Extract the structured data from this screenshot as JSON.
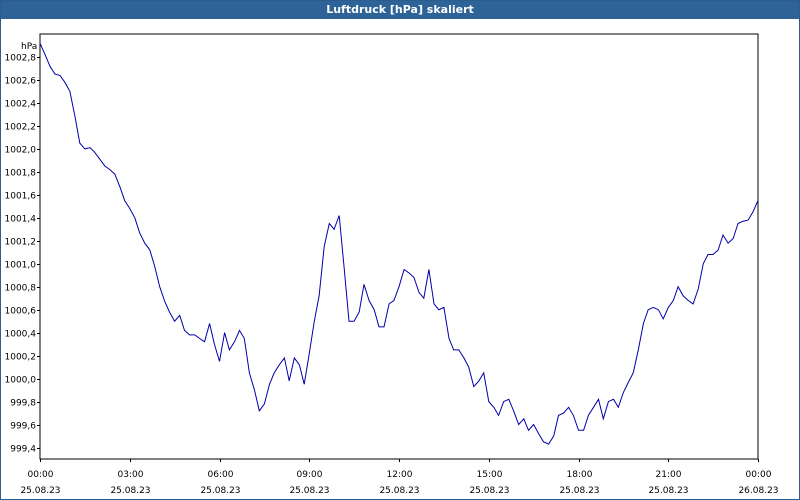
{
  "window": {
    "title": "Luftdruck [hPa] skaliert"
  },
  "chart_data": {
    "type": "line",
    "title": "Luftdruck [hPa] skaliert",
    "ylabel": "hPa",
    "xlabel": "",
    "ylim": [
      999.3,
      1003.0
    ],
    "xlim": [
      0,
      24
    ],
    "grid": true,
    "y_ticks": [
      {
        "value": 999.4,
        "label": "999,4"
      },
      {
        "value": 999.6,
        "label": "999,6"
      },
      {
        "value": 999.8,
        "label": "999,8"
      },
      {
        "value": 1000.0,
        "label": "1000,0"
      },
      {
        "value": 1000.2,
        "label": "1000,2"
      },
      {
        "value": 1000.4,
        "label": "1000,4"
      },
      {
        "value": 1000.6,
        "label": "1000,6"
      },
      {
        "value": 1000.8,
        "label": "1000,8"
      },
      {
        "value": 1001.0,
        "label": "1001,0"
      },
      {
        "value": 1001.2,
        "label": "1001,2"
      },
      {
        "value": 1001.4,
        "label": "1001,4"
      },
      {
        "value": 1001.6,
        "label": "1001,6"
      },
      {
        "value": 1001.8,
        "label": "1001,8"
      },
      {
        "value": 1002.0,
        "label": "1002,0"
      },
      {
        "value": 1002.2,
        "label": "1002,2"
      },
      {
        "value": 1002.4,
        "label": "1002,4"
      },
      {
        "value": 1002.6,
        "label": "1002,6"
      },
      {
        "value": 1002.8,
        "label": "1002,8"
      }
    ],
    "x_ticks": [
      {
        "value": 0,
        "time": "00:00",
        "date": "25.08.23"
      },
      {
        "value": 3,
        "time": "03:00",
        "date": "25.08.23"
      },
      {
        "value": 6,
        "time": "06:00",
        "date": "25.08.23"
      },
      {
        "value": 9,
        "time": "09:00",
        "date": "25.08.23"
      },
      {
        "value": 12,
        "time": "12:00",
        "date": "25.08.23"
      },
      {
        "value": 15,
        "time": "15:00",
        "date": "25.08.23"
      },
      {
        "value": 18,
        "time": "18:00",
        "date": "25.08.23"
      },
      {
        "value": 21,
        "time": "21:00",
        "date": "25.08.23"
      },
      {
        "value": 24,
        "time": "00:00",
        "date": "26.08.23"
      }
    ],
    "line_color": "#0000aa",
    "series": [
      {
        "x": [
          0,
          0.17,
          0.33,
          0.5,
          0.67,
          0.83,
          1.0,
          1.17,
          1.33,
          1.5,
          1.67,
          1.83,
          2.0,
          2.17,
          2.33,
          2.5,
          2.67,
          2.83,
          3.0,
          3.17,
          3.33,
          3.5,
          3.67,
          3.83,
          4.0,
          4.17,
          4.33,
          4.5,
          4.67,
          4.83,
          5.0,
          5.17,
          5.33,
          5.5,
          5.67,
          5.83,
          6.0,
          6.17,
          6.33,
          6.5,
          6.67,
          6.83,
          7.0,
          7.17,
          7.33,
          7.5,
          7.67,
          7.83,
          8.0,
          8.17,
          8.33,
          8.5,
          8.67,
          8.83,
          9.0,
          9.17,
          9.33,
          9.5,
          9.67,
          9.83,
          10.0,
          10.17,
          10.33,
          10.5,
          10.67,
          10.83,
          11.0,
          11.17,
          11.33,
          11.5,
          11.67,
          11.83,
          12.0,
          12.17,
          12.33,
          12.5,
          12.67,
          12.83,
          13.0,
          13.17,
          13.33,
          13.5,
          13.67,
          13.83,
          14.0,
          14.17,
          14.33,
          14.5,
          14.67,
          14.83,
          15.0,
          15.17,
          15.33,
          15.5,
          15.67,
          15.83,
          16.0,
          16.17,
          16.33,
          16.5,
          16.67,
          16.83,
          17.0,
          17.17,
          17.33,
          17.5,
          17.67,
          17.83,
          18.0,
          18.17,
          18.33,
          18.5,
          18.67,
          18.83,
          19.0,
          19.17,
          19.33,
          19.5,
          19.67,
          19.83,
          20.0,
          20.17,
          20.33,
          20.5,
          20.67,
          20.83,
          21.0,
          21.17,
          21.33,
          21.5,
          21.67,
          21.83,
          22.0,
          22.17,
          22.33,
          22.5,
          22.67,
          22.83,
          23.0,
          23.17,
          23.33,
          23.5,
          23.67,
          23.83,
          24.0
        ],
        "y": [
          1002.92,
          1002.82,
          1002.72,
          1002.65,
          1002.64,
          1002.58,
          1002.5,
          1002.28,
          1002.05,
          1002.0,
          1002.01,
          1001.97,
          1001.91,
          1001.85,
          1001.82,
          1001.78,
          1001.67,
          1001.55,
          1001.48,
          1001.4,
          1001.27,
          1001.18,
          1001.12,
          1000.98,
          1000.8,
          1000.67,
          1000.58,
          1000.5,
          1000.55,
          1000.42,
          1000.38,
          1000.38,
          1000.35,
          1000.32,
          1000.48,
          1000.3,
          1000.15,
          1000.4,
          1000.25,
          1000.32,
          1000.42,
          1000.35,
          1000.05,
          999.9,
          999.72,
          999.78,
          999.95,
          1000.05,
          1000.12,
          1000.18,
          999.98,
          1000.18,
          1000.12,
          999.95,
          1000.22,
          1000.5,
          1000.72,
          1001.15,
          1001.35,
          1001.3,
          1001.42,
          1000.95,
          1000.5,
          1000.5,
          1000.58,
          1000.82,
          1000.68,
          1000.6,
          1000.45,
          1000.45,
          1000.65,
          1000.68,
          1000.8,
          1000.95,
          1000.92,
          1000.88,
          1000.75,
          1000.7,
          1000.95,
          1000.65,
          1000.6,
          1000.62,
          1000.35,
          1000.25,
          1000.25,
          1000.18,
          1000.1,
          999.93,
          999.98,
          1000.05,
          999.8,
          999.75,
          999.68,
          999.8,
          999.82,
          999.72,
          999.6,
          999.65,
          999.55,
          999.6,
          999.52,
          999.45,
          999.43,
          999.5,
          999.68,
          999.7,
          999.75,
          999.68,
          999.55,
          999.55,
          999.68,
          999.75,
          999.82,
          999.65,
          999.8,
          999.82,
          999.75,
          999.88,
          999.97,
          1000.05,
          1000.25,
          1000.48,
          1000.6,
          1000.62,
          1000.6,
          1000.52,
          1000.62,
          1000.68,
          1000.8,
          1000.72,
          1000.68,
          1000.65,
          1000.78,
          1001.0,
          1001.08,
          1001.08,
          1001.12,
          1001.25,
          1001.18,
          1001.22,
          1001.35,
          1001.37,
          1001.38,
          1001.45,
          1001.55
        ]
      }
    ]
  }
}
